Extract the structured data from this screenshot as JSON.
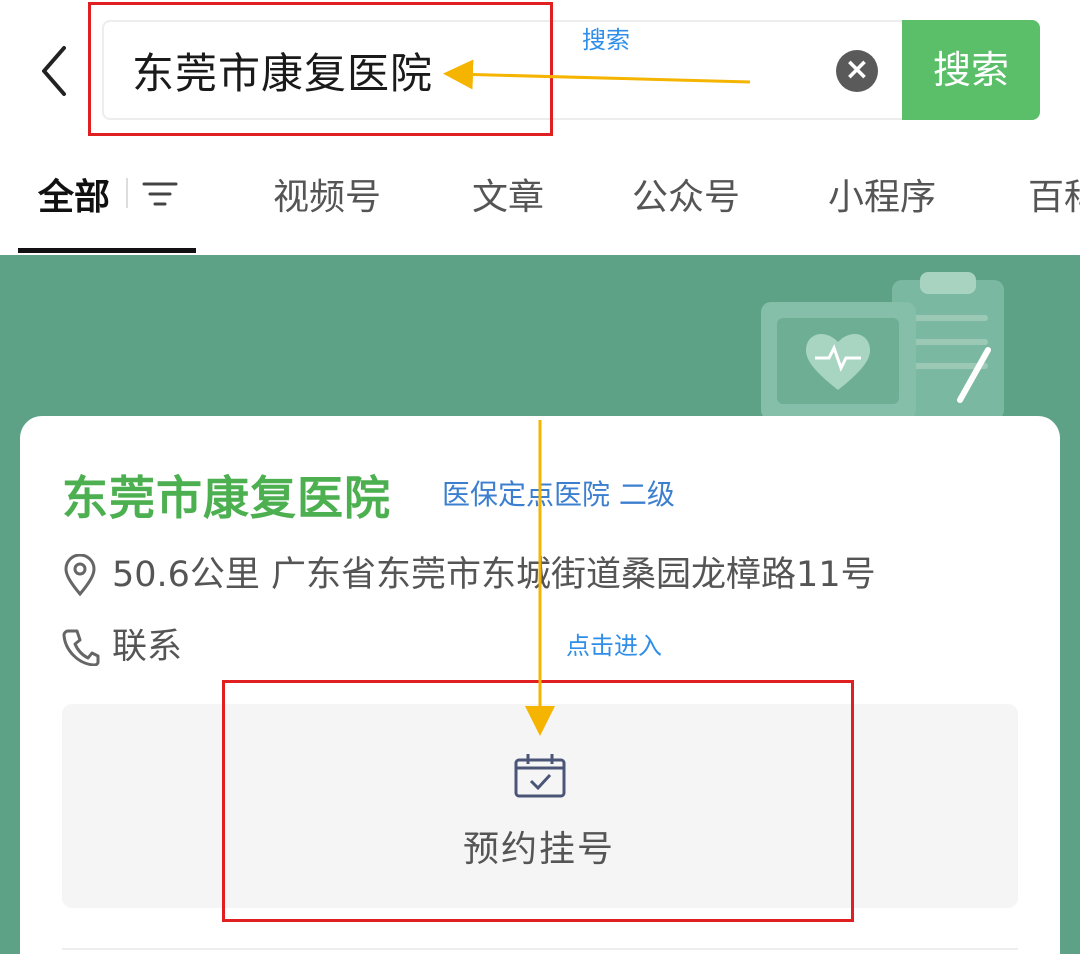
{
  "search": {
    "query": "东莞市康复医院",
    "button_label": "搜索",
    "clear_icon": "clear-icon",
    "back_icon": "back-chevron-icon"
  },
  "tabs": [
    {
      "label": "全部",
      "active": true
    },
    {
      "label": "视频号"
    },
    {
      "label": "文章"
    },
    {
      "label": "公众号"
    },
    {
      "label": "小程序"
    },
    {
      "label": "百科"
    }
  ],
  "hospital": {
    "name": "东莞市康复医院",
    "tag": "医保定点医院 二级",
    "address": "50.6公里 广东省东莞市东城街道桑园龙樟路11号",
    "contact_label": "联系",
    "booking_label": "预约挂号"
  },
  "annotations": {
    "search_note": "搜索",
    "enter_note": "点击进入"
  },
  "colors": {
    "accent_green": "#5bbf6a",
    "banner_green": "#5da287",
    "hospital_name": "#4caf50",
    "tag_blue": "#3d7fcf",
    "annotation_red": "#e02020",
    "annotation_arrow": "#f5b400"
  }
}
